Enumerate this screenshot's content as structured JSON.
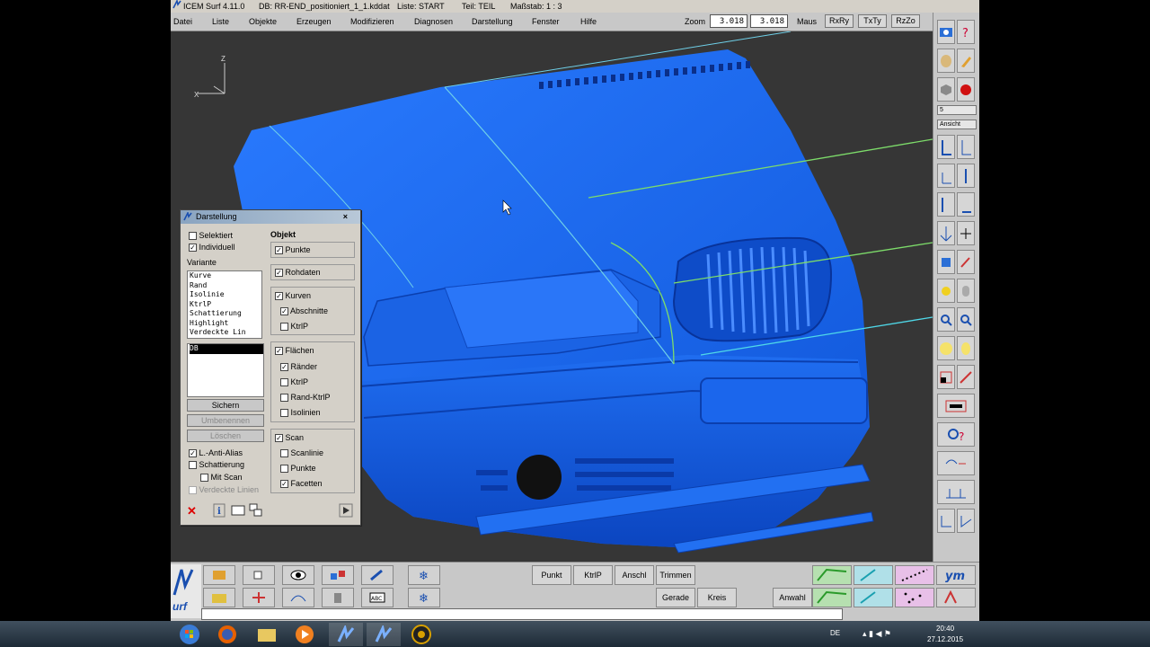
{
  "window": {
    "title": "ICEM Surf 4.11.0",
    "file": "DB: RR-END_positioniert_1_1.kddat",
    "liste": "Liste: START",
    "teil": "Teil: TEIL",
    "massstab": "Maßstab: 1 : 3"
  },
  "menu": [
    "Datei",
    "Liste",
    "Objekte",
    "Erzeugen",
    "Modifizieren",
    "Diagnosen",
    "Darstellung",
    "Fenster",
    "Hilfe"
  ],
  "zoom": {
    "label": "Zoom",
    "value1": "3.018",
    "value2": "3.018",
    "maus_label": "Maus",
    "buttons": [
      "RxRy",
      "TxTy",
      "RzZo"
    ]
  },
  "axis": {
    "z": "Z",
    "x": "X"
  },
  "right_toolbar": {
    "select_number": "5",
    "select_view": "Ansicht"
  },
  "panel": {
    "title": "Darstellung",
    "selektiert": "Selektiert",
    "individuell": "Individuell",
    "variante_label": "Variante",
    "variante_items": [
      "Kurve",
      "Rand",
      "Isolinie",
      "KtrlP",
      "Schattierung",
      "Highlight",
      "Verdeckte Lin"
    ],
    "db_item": "DB",
    "btn_sichern": "Sichern",
    "btn_umbenennen": "Umbenennen",
    "btn_loeschen": "Löschen",
    "anti_alias": "L.-Anti-Alias",
    "schattierung": "Schattierung",
    "mit_scan": "Mit Scan",
    "verdeckte_linien": "Verdeckte Linien",
    "objekt_label": "Objekt",
    "punkte": "Punkte",
    "rohdaten": "Rohdaten",
    "kurven": "Kurven",
    "abschnitte": "Abschnitte",
    "ktrlp": "KtrlP",
    "flaechen": "Flächen",
    "raender": "Ränder",
    "ktrlp2": "KtrlP",
    "rand_ktrlp": "Rand-KtrlP",
    "isolinien": "Isolinien",
    "scan": "Scan",
    "scanlinie": "Scanlinie",
    "scan_punkte": "Punkte",
    "facetten": "Facetten"
  },
  "bottom_buttons": {
    "punkt": "Punkt",
    "ktrlp": "KtrlP",
    "anschl": "Anschl",
    "trimmen": "Trimmen",
    "gerade": "Gerade",
    "kreis": "Kreis",
    "anwahl": "Anwahl",
    "logo": "urf"
  },
  "taskbar": {
    "lang": "DE",
    "time": "20:40",
    "date": "27.12.2015"
  },
  "colors": {
    "car_blue": "#1a63e8",
    "viewport_bg": "#363636",
    "curve_green": "#7ddc6a",
    "curve_cyan": "#4fd8e8"
  }
}
